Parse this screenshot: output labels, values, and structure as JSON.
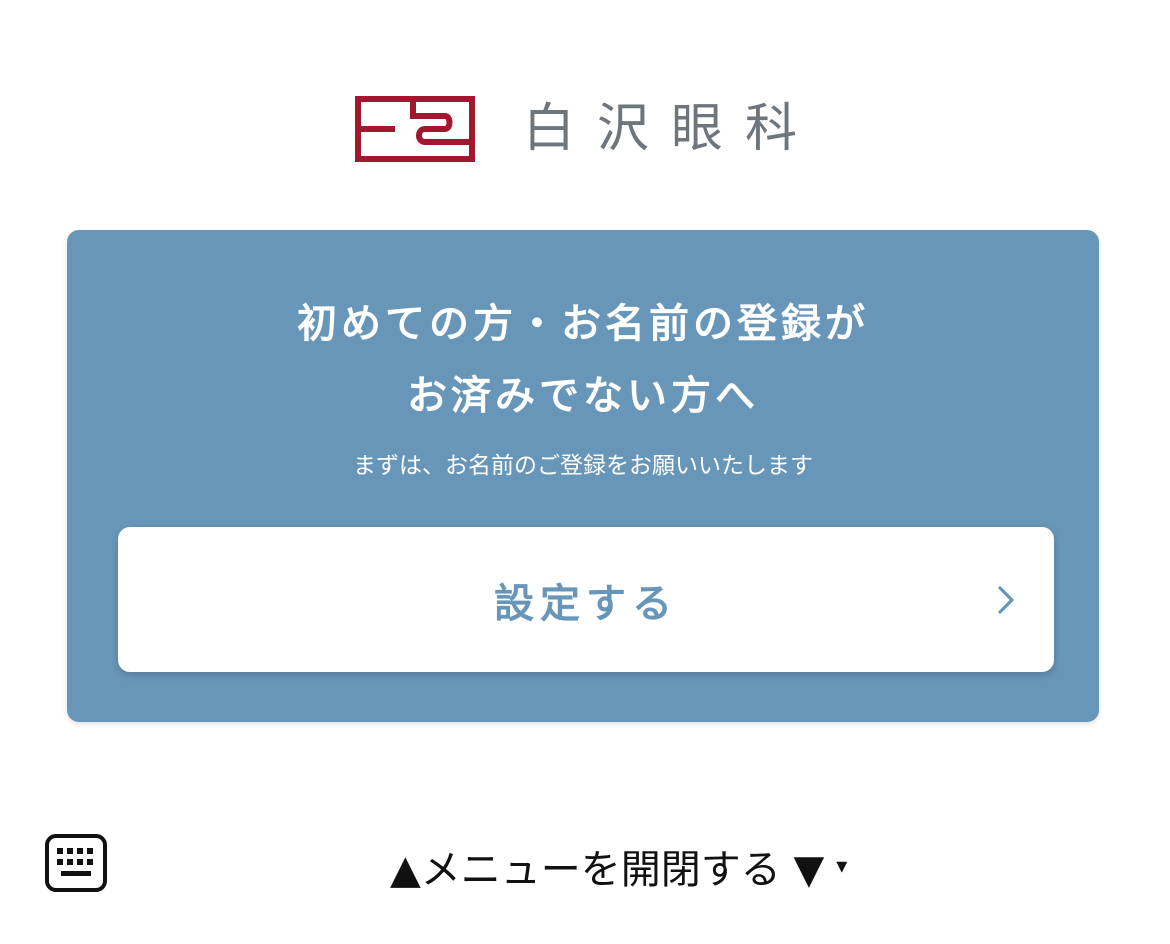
{
  "header": {
    "logo_name": "白沢眼科",
    "logo_mark_color": "#a3172e",
    "logo_mark_icon": "clinic-logo-mark"
  },
  "card": {
    "background": "#6896b9",
    "title_line1": "初めての方・お名前の登録が",
    "title_line2": "お済みでない方へ",
    "subtitle": "まずは、お名前のご登録をお願いいたします",
    "button_label": "設定する",
    "button_icon": "chevron-right-icon"
  },
  "bottom_bar": {
    "keyboard_icon": "keyboard-icon",
    "menu_label": "▲メニューを開閉する ▼",
    "menu_caret": "▾"
  }
}
